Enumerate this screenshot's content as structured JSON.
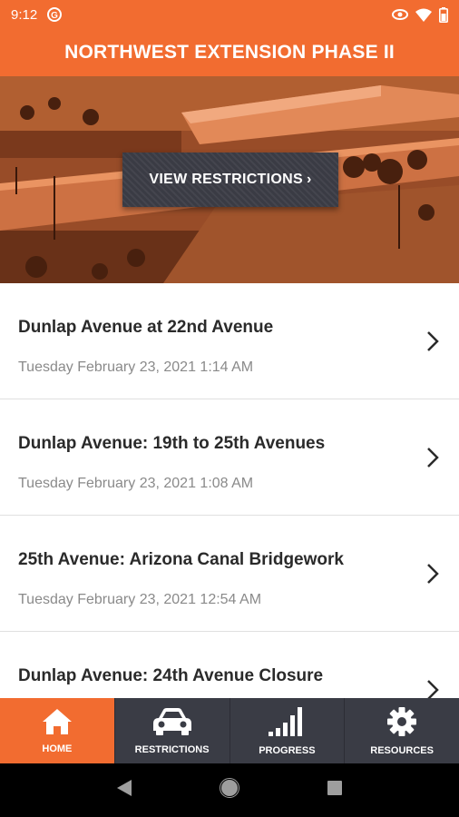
{
  "status": {
    "time": "9:12",
    "icons": [
      "sync-icon",
      "eye-icon",
      "wifi-icon",
      "battery-icon"
    ]
  },
  "app_bar": {
    "title": "NORTHWEST EXTENSION PHASE II"
  },
  "hero": {
    "button_label": "VIEW RESTRICTIONS",
    "button_chevron": "›"
  },
  "list": {
    "items": [
      {
        "title": "Dunlap Avenue at 22nd Avenue",
        "date": "Tuesday February 23, 2021 1:14 AM"
      },
      {
        "title": "Dunlap Avenue: 19th to 25th Avenues",
        "date": "Tuesday February 23, 2021 1:08 AM"
      },
      {
        "title": "25th Avenue: Arizona Canal Bridgework",
        "date": "Tuesday February 23, 2021 12:54 AM"
      },
      {
        "title": "Dunlap Avenue: 24th Avenue Closure",
        "date": ""
      }
    ]
  },
  "bottom_nav": {
    "items": [
      {
        "label": "HOME",
        "icon": "home-icon",
        "active": true
      },
      {
        "label": "RESTRICTIONS",
        "icon": "car-icon",
        "active": false
      },
      {
        "label": "PROGRESS",
        "icon": "signal-bars-icon",
        "active": false
      },
      {
        "label": "RESOURCES",
        "icon": "gear-icon",
        "active": false
      }
    ]
  },
  "colors": {
    "accent": "#f26c30",
    "nav_bg": "#3a3c45",
    "title_text": "#2a2a2a",
    "date_text": "#8a8a8a"
  }
}
